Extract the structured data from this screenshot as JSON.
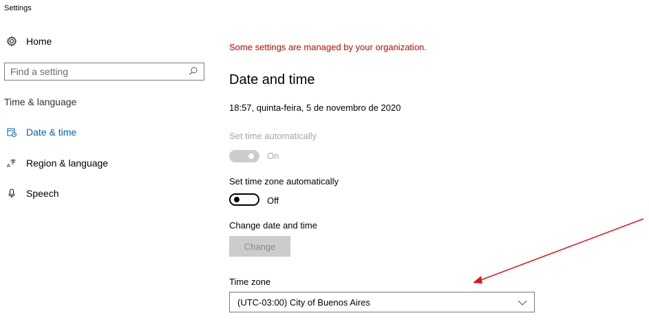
{
  "window": {
    "title": "Settings"
  },
  "sidebar": {
    "home_label": "Home",
    "search_placeholder": "Find a setting",
    "section_label": "Time & language",
    "items": [
      {
        "label": "Date & time",
        "icon": "calendar-clock-icon",
        "active": true
      },
      {
        "label": "Region & language",
        "icon": "language-icon",
        "active": false
      },
      {
        "label": "Speech",
        "icon": "microphone-icon",
        "active": false
      }
    ]
  },
  "main": {
    "managed_notice": "Some settings are managed by your organization.",
    "title": "Date and time",
    "current_time": "18:57, quinta-feira, 5 de novembro de 2020",
    "set_time_auto": {
      "label": "Set time automatically",
      "state": "On"
    },
    "set_tz_auto": {
      "label": "Set time zone automatically",
      "state": "Off"
    },
    "change_date": {
      "label": "Change date and time",
      "button": "Change"
    },
    "time_zone": {
      "label": "Time zone",
      "value": "(UTC-03:00) City of Buenos Aires"
    }
  },
  "colors": {
    "accent": "#0063b1",
    "warning": "#c50500",
    "arrow": "#e0161b"
  }
}
